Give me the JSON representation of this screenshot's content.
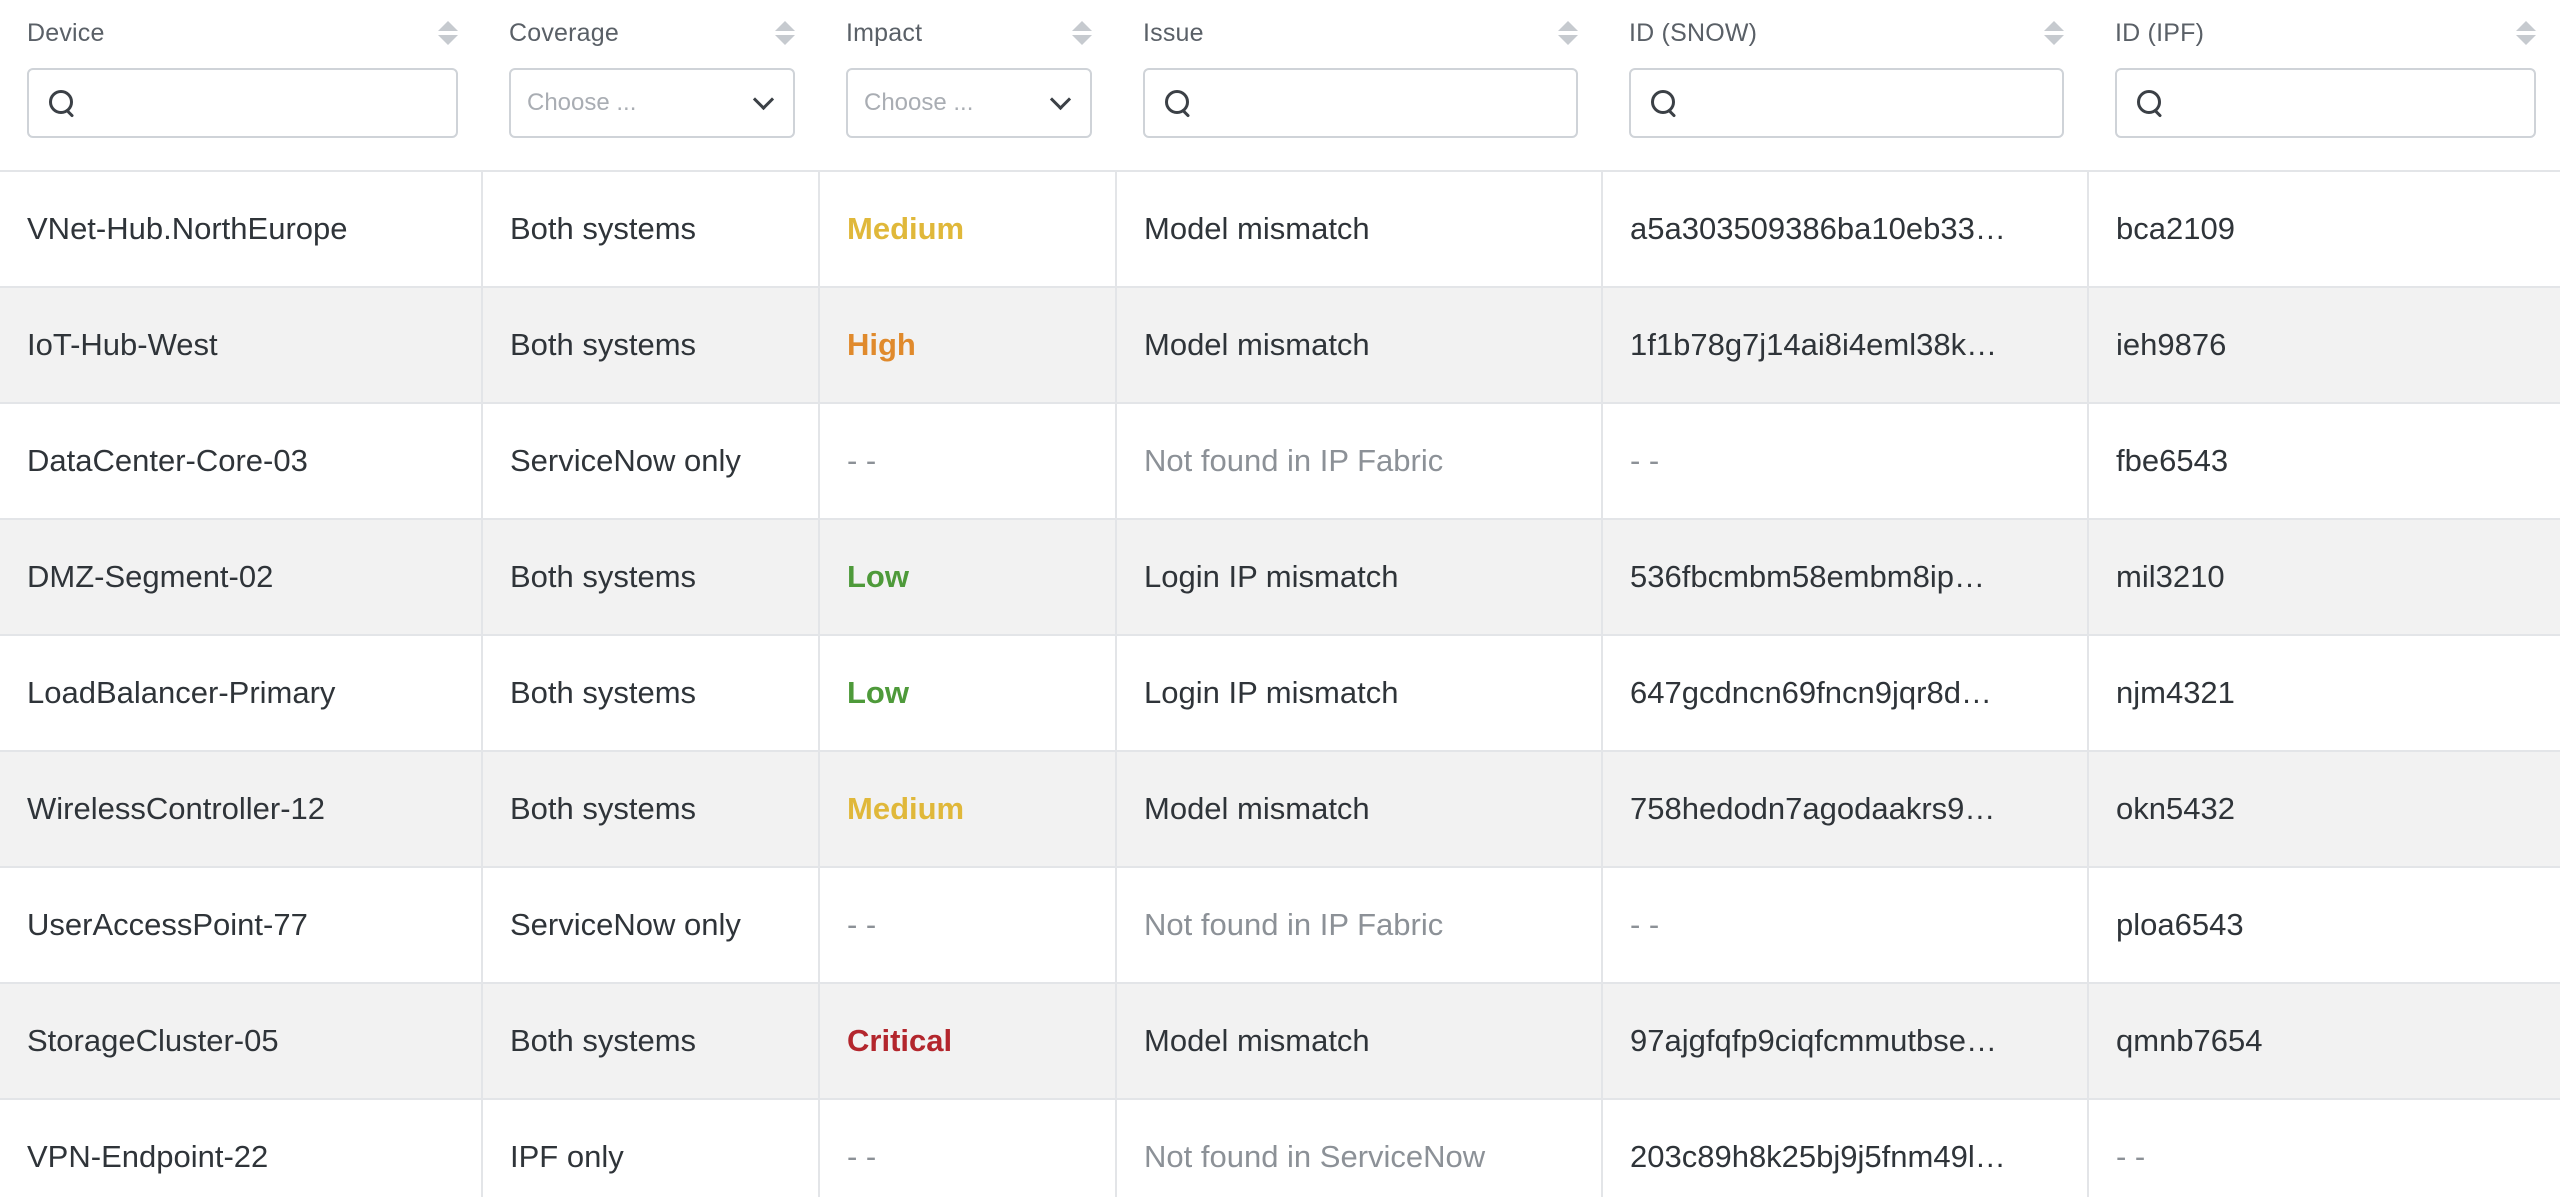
{
  "columns": [
    {
      "key": "device",
      "label": "Device",
      "filter": {
        "type": "search",
        "value": "",
        "placeholder": ""
      }
    },
    {
      "key": "coverage",
      "label": "Coverage",
      "filter": {
        "type": "select",
        "placeholder": "Choose ..."
      }
    },
    {
      "key": "impact",
      "label": "Impact",
      "filter": {
        "type": "select",
        "placeholder": "Choose ..."
      }
    },
    {
      "key": "issue",
      "label": "Issue",
      "filter": {
        "type": "search",
        "value": "",
        "placeholder": ""
      }
    },
    {
      "key": "id_snow",
      "label": "ID (SNOW)",
      "filter": {
        "type": "search",
        "value": "",
        "placeholder": ""
      }
    },
    {
      "key": "id_ipf",
      "label": "ID (IPF)",
      "filter": {
        "type": "search",
        "value": "",
        "placeholder": ""
      }
    }
  ],
  "impact_colors": {
    "Medium": "#e0b83a",
    "High": "#e08a2c",
    "Low": "#4e9a3a",
    "Critical": "#b3262d"
  },
  "rows": [
    {
      "device": "VNet-Hub.NorthEurope",
      "coverage": "Both systems",
      "impact": "Medium",
      "issue": "Model mismatch",
      "issue_muted": false,
      "id_snow": "a5a303509386ba10eb33…",
      "id_ipf": "bca2109"
    },
    {
      "device": "IoT-Hub-West",
      "coverage": "Both systems",
      "impact": "High",
      "issue": "Model mismatch",
      "issue_muted": false,
      "id_snow": "1f1b78g7j14ai8i4eml38k…",
      "id_ipf": "ieh9876"
    },
    {
      "device": "DataCenter-Core-03",
      "coverage": "ServiceNow only",
      "impact": "- -",
      "issue": "Not found in IP Fabric",
      "issue_muted": true,
      "id_snow": "- -",
      "id_ipf": "fbe6543"
    },
    {
      "device": "DMZ-Segment-02",
      "coverage": "Both systems",
      "impact": "Low",
      "issue": "Login IP mismatch",
      "issue_muted": false,
      "id_snow": "536fbcmbm58embm8ip…",
      "id_ipf": "mil3210"
    },
    {
      "device": "LoadBalancer-Primary",
      "coverage": "Both systems",
      "impact": "Low",
      "issue": "Login IP mismatch",
      "issue_muted": false,
      "id_snow": "647gcdncn69fncn9jqr8d…",
      "id_ipf": "njm4321"
    },
    {
      "device": "WirelessController-12",
      "coverage": "Both systems",
      "impact": "Medium",
      "issue": "Model mismatch",
      "issue_muted": false,
      "id_snow": "758hedodn7agodaakrs9…",
      "id_ipf": "okn5432"
    },
    {
      "device": "UserAccessPoint-77",
      "coverage": "ServiceNow only",
      "impact": "- -",
      "issue": "Not found in IP Fabric",
      "issue_muted": true,
      "id_snow": "- -",
      "id_ipf": "ploa6543"
    },
    {
      "device": "StorageCluster-05",
      "coverage": "Both systems",
      "impact": "Critical",
      "issue": "Model mismatch",
      "issue_muted": false,
      "id_snow": "97ajgfqfp9ciqfcmmutbse…",
      "id_ipf": "qmnb7654"
    },
    {
      "device": "VPN-Endpoint-22",
      "coverage": "IPF only",
      "impact": "- -",
      "issue": "Not found in ServiceNow",
      "issue_muted": true,
      "id_snow": "203c89h8k25bj9j5fnm49l…",
      "id_ipf": "- -"
    }
  ]
}
